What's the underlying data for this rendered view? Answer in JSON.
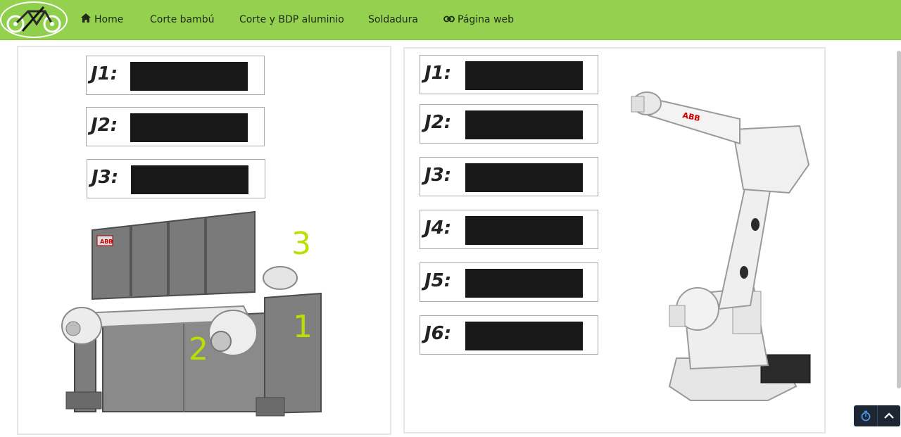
{
  "nav": {
    "items": [
      {
        "label": "Home",
        "icon": "home-icon"
      },
      {
        "label": "Corte bambú"
      },
      {
        "label": "Corte y BDP aluminio"
      },
      {
        "label": "Soldadura"
      },
      {
        "label": "Página web",
        "icon": "link-icon"
      }
    ]
  },
  "positioner": {
    "joints": [
      {
        "label": "J1:",
        "value": ""
      },
      {
        "label": "J2:",
        "value": ""
      },
      {
        "label": "J3:",
        "value": ""
      }
    ],
    "image_numbers": [
      "1",
      "2",
      "3"
    ],
    "brand_badge": "ABB"
  },
  "robot": {
    "joints": [
      {
        "label": "J1:",
        "value": ""
      },
      {
        "label": "J2:",
        "value": ""
      },
      {
        "label": "J3:",
        "value": ""
      },
      {
        "label": "J4:",
        "value": ""
      },
      {
        "label": "J5:",
        "value": ""
      },
      {
        "label": "J6:",
        "value": ""
      }
    ],
    "brand_badge": "ABB"
  },
  "widgets": {
    "timer_icon": "stopwatch-icon",
    "scroll_top_icon": "chevron-up-icon"
  },
  "colors": {
    "navbar": "#93d14f",
    "value_box": "#181818",
    "number_accent": "#b8e000"
  }
}
